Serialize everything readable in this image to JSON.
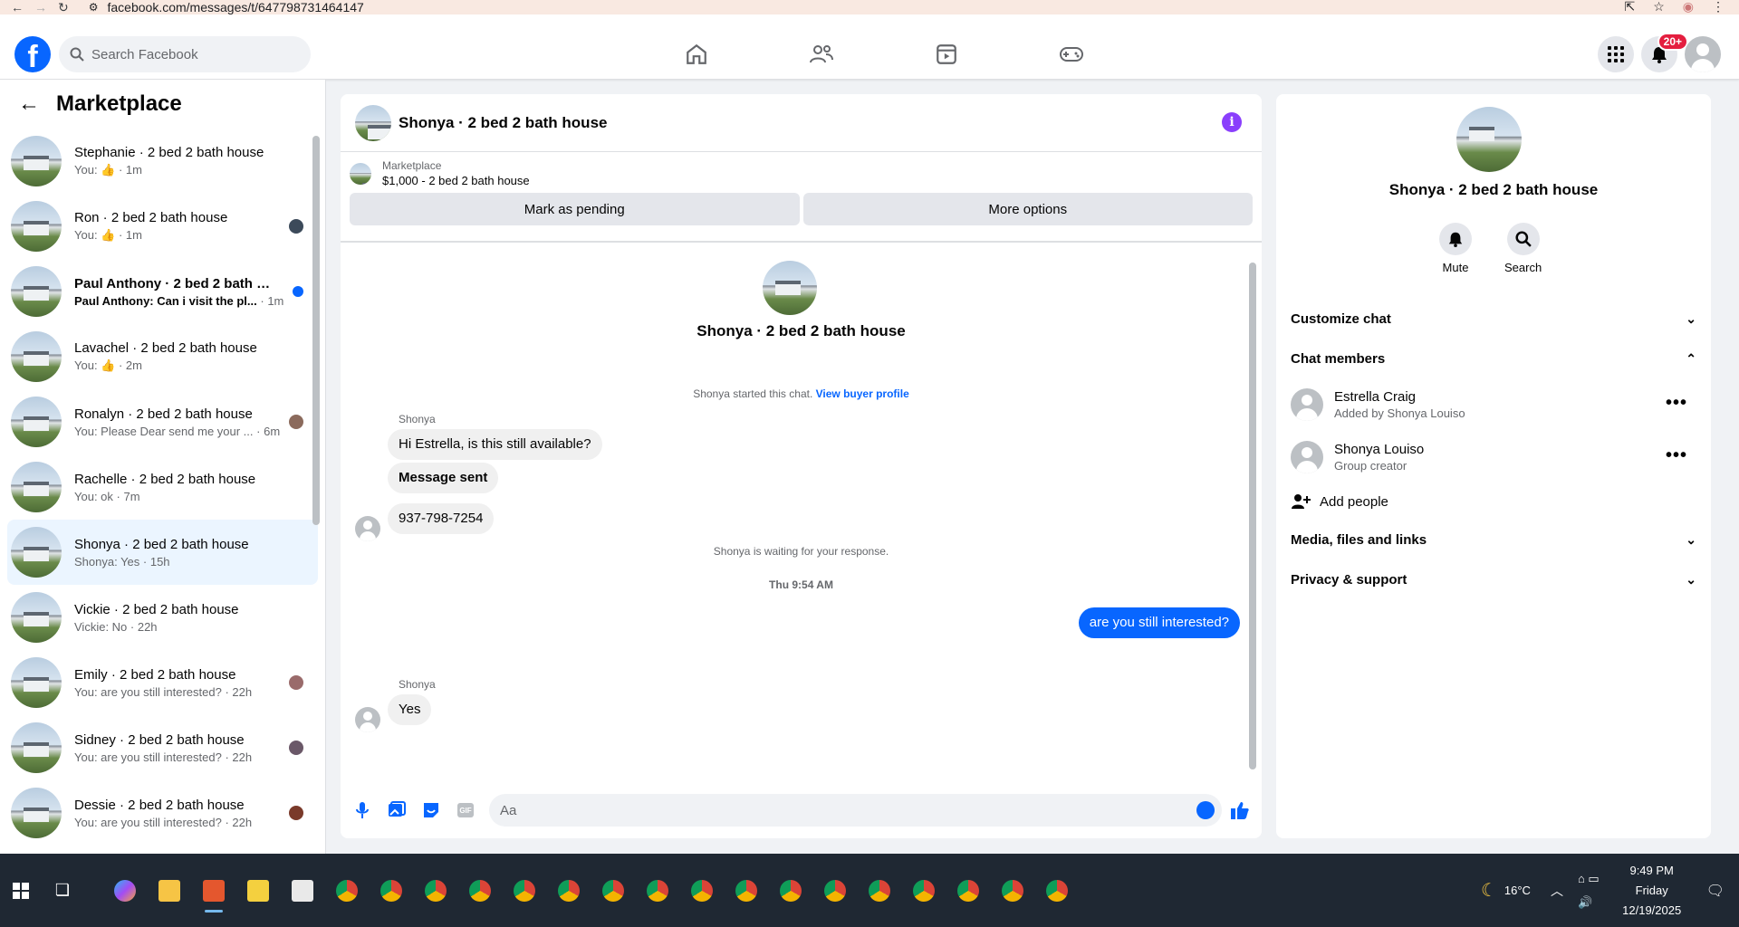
{
  "browser": {
    "url": "facebook.com/messages/t/647798731464147"
  },
  "header": {
    "logo": "f",
    "search_placeholder": "Search Facebook",
    "notifications_badge": "20+"
  },
  "sidebar": {
    "title": "Marketplace",
    "conversations": [
      {
        "title": "Stephanie · 2 bed 2 bath house",
        "prefix": "You: ",
        "like": true,
        "time": " · 1m",
        "preview": ""
      },
      {
        "title": "Ron · 2 bed 2 bath house",
        "prefix": "You: ",
        "like": true,
        "time": " · 1m",
        "preview": ""
      },
      {
        "title": "Paul Anthony · 2 bed 2 bath h...",
        "prefix": "",
        "like": false,
        "time": " · 1m",
        "preview": "Paul Anthony: Can i visit the pl..."
      },
      {
        "title": "Lavachel · 2 bed 2 bath house",
        "prefix": "You: ",
        "like": true,
        "time": " · 2m",
        "preview": ""
      },
      {
        "title": "Ronalyn · 2 bed 2 bath house",
        "prefix": "",
        "like": false,
        "time": " · 6m",
        "preview": "You: Please Dear send me your ..."
      },
      {
        "title": "Rachelle · 2 bed 2 bath house",
        "prefix": "",
        "like": false,
        "time": " · 7m",
        "preview": "You: ok"
      },
      {
        "title": "Shonya · 2 bed 2 bath house",
        "prefix": "",
        "like": false,
        "time": " · 15h",
        "preview": "Shonya: Yes"
      },
      {
        "title": "Vickie · 2 bed 2 bath house",
        "prefix": "",
        "like": false,
        "time": " · 22h",
        "preview": "Vickie: No"
      },
      {
        "title": "Emily · 2 bed 2 bath house",
        "prefix": "",
        "like": false,
        "time": " · 22h",
        "preview": "You: are you still interested?"
      },
      {
        "title": "Sidney · 2 bed 2 bath house",
        "prefix": "",
        "like": false,
        "time": " · 22h",
        "preview": "You: are you still interested?"
      },
      {
        "title": "Dessie · 2 bed 2 bath house",
        "prefix": "",
        "like": false,
        "time": " · 22h",
        "preview": "You: are you still interested?"
      }
    ]
  },
  "chat": {
    "title": "Shonya · 2 bed 2 bath house",
    "marketplace_label": "Marketplace",
    "listing": "$1,000 - 2 bed 2 bath house",
    "mark_pending": "Mark as pending",
    "more_options": "More options",
    "conversation_name": "Shonya · 2 bed 2 bath house",
    "started_text": "Shonya started this chat.",
    "view_buyer_profile": "View buyer profile",
    "sender_1": "Shonya",
    "msg_1": "Hi Estrella, is this still available?",
    "msg_2": "Message sent",
    "msg_3": "937-798-7254",
    "waiting_text": "Shonya is waiting for your response.",
    "timestamp": "Thu 9:54 AM",
    "my_msg": "are you still interested?",
    "sender_2": "Shonya",
    "msg_4": "Yes",
    "composer_placeholder": "Aa",
    "gif_label": "GIF"
  },
  "info_panel": {
    "name": "Shonya · 2 bed 2 bath house",
    "mute": "Mute",
    "search": "Search",
    "customize_chat": "Customize chat",
    "chat_members": "Chat members",
    "members": [
      {
        "name": "Estrella Craig",
        "role": "Added by Shonya Louiso"
      },
      {
        "name": "Shonya Louiso",
        "role": "Group creator"
      }
    ],
    "add_people": "Add people",
    "media_files_links": "Media, files and links",
    "privacy_support": "Privacy & support"
  },
  "taskbar": {
    "temperature": "16°C",
    "time": "9:49 PM",
    "day": "Friday",
    "date": "12/19/2025"
  }
}
